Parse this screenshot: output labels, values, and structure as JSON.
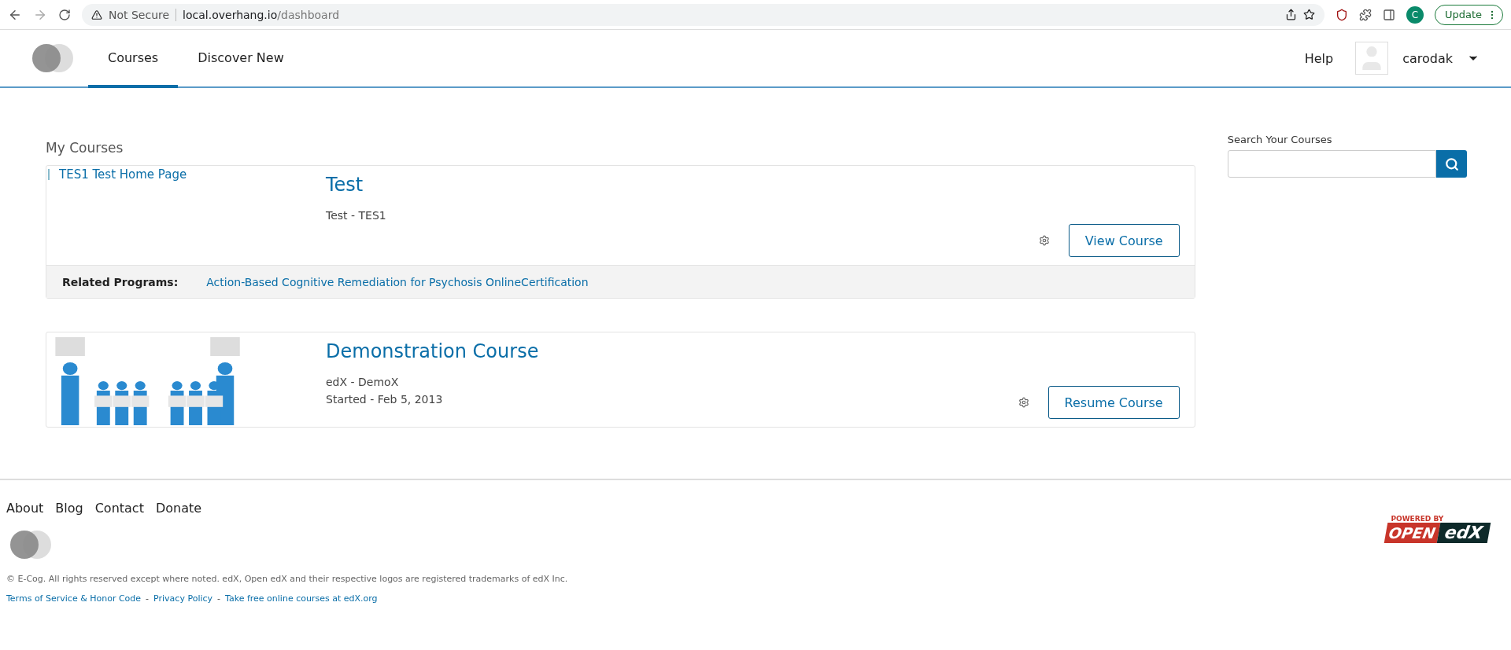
{
  "browser": {
    "security": "Not Secure",
    "url_host": "local.overhang.io",
    "url_path": "/dashboard",
    "profile_initial": "C",
    "update_label": "Update"
  },
  "header": {
    "tabs": [
      {
        "label": "Courses",
        "selected": true
      },
      {
        "label": "Discover New",
        "selected": false
      }
    ],
    "help": "Help",
    "username": "carodak"
  },
  "main": {
    "heading": "My Courses",
    "courses": [
      {
        "image_alt": "TES1 Test Home Page",
        "title": "Test",
        "details": [
          "Test - TES1"
        ],
        "action": "View Course",
        "related_label": "Related Programs:",
        "related_program": "Action-Based Cognitive Remediation for Psychosis OnlineCertification"
      },
      {
        "title": "Demonstration Course",
        "details": [
          "edX - DemoX",
          "Started - Feb 5, 2013"
        ],
        "action": "Resume Course"
      }
    ]
  },
  "search": {
    "label": "Search Your Courses"
  },
  "footer": {
    "links": [
      "About",
      "Blog",
      "Contact",
      "Donate"
    ],
    "copyright": "© E-Cog. All rights reserved except where noted. edX, Open edX and their respective logos are registered trademarks of edX Inc.",
    "legal_separator": "-",
    "legal_links": [
      "Terms of Service & Honor Code",
      "Privacy Policy",
      "Take free online courses at edX.org"
    ],
    "badge": {
      "caption": "POWERED BY",
      "open": "OPEN",
      "edx": "edX"
    }
  }
}
